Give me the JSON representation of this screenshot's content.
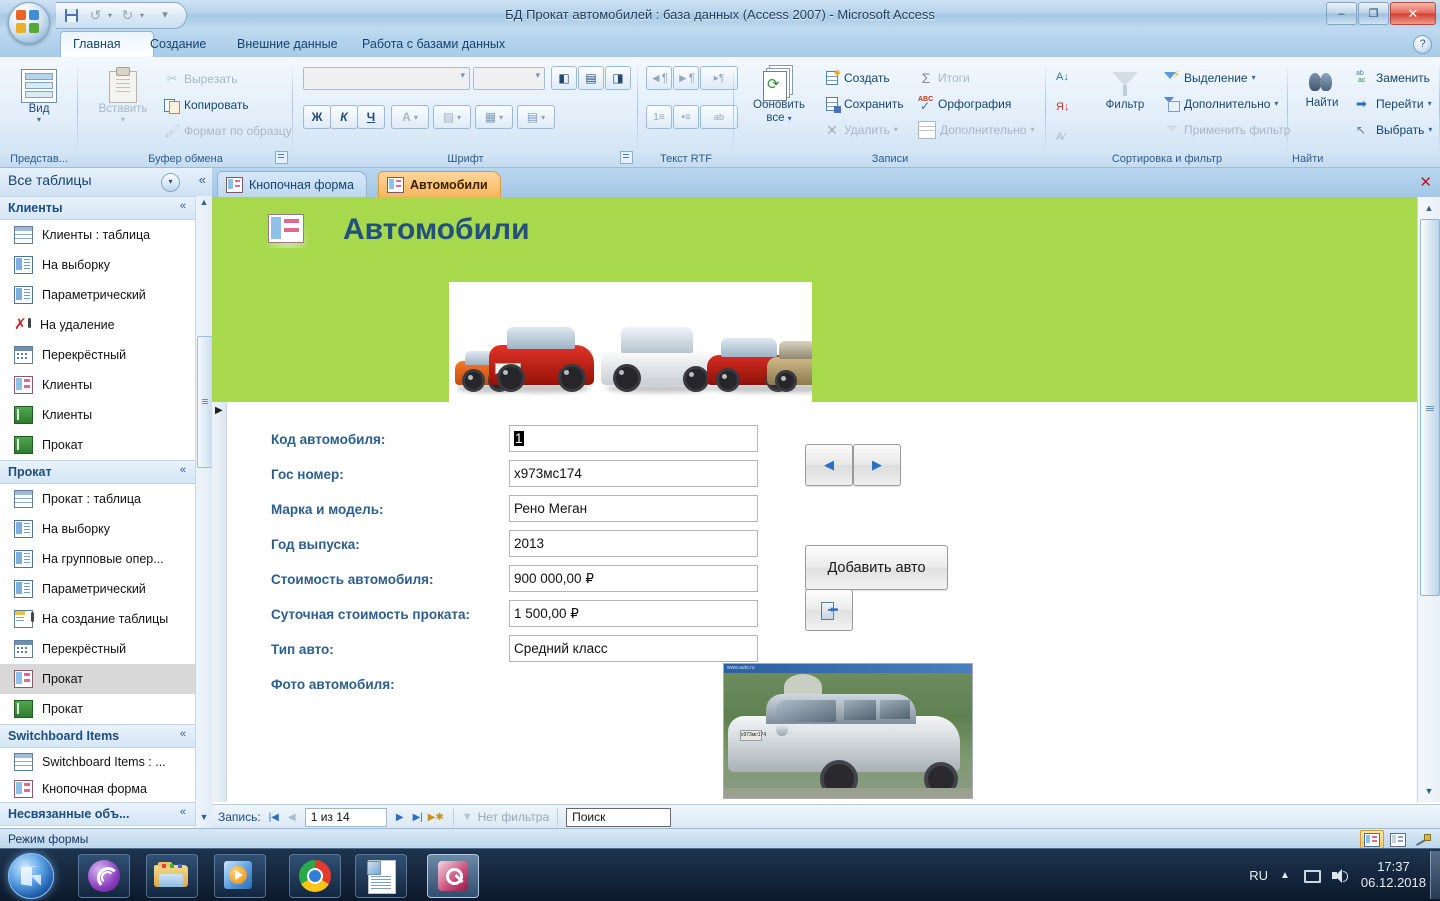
{
  "window": {
    "title": "БД Прокат автомобилей : база данных (Access 2007) - Microsoft Access",
    "minimize": "–",
    "restore": "❐",
    "close": "✕",
    "help": "?"
  },
  "quick_access": {
    "save": "save-icon",
    "undo": "↺",
    "redo": "↻",
    "customize": "▾"
  },
  "ribbon": {
    "tabs": [
      {
        "label": "Главная",
        "active": true
      },
      {
        "label": "Создание",
        "active": false
      },
      {
        "label": "Внешние данные",
        "active": false
      },
      {
        "label": "Работа с базами данных",
        "active": false
      }
    ],
    "groups": [
      {
        "name": "Представ...",
        "big_button": {
          "label": "Вид",
          "caret": "▾"
        }
      },
      {
        "name": "Буфер обмена",
        "paste": "Вставить",
        "paste_caret": "▾",
        "items": [
          {
            "label": "Вырезать",
            "dim": true,
            "icon": "scissors-icon"
          },
          {
            "label": "Копировать",
            "dim": false,
            "icon": "copy-icon"
          },
          {
            "label": "Формат по образцу",
            "dim": true,
            "icon": "format-painter-icon"
          }
        ]
      },
      {
        "name": "Шрифт",
        "bold": "Ж",
        "italic": "К",
        "underline": "Ч",
        "font_color": "A",
        "fill_color": "▨",
        "gridlines": "▦",
        "alt_fill": "▤",
        "align_left": "◧",
        "align_center": "▤",
        "align_right": "◨"
      },
      {
        "name": "Текст RTF",
        "indent_dec": "◄¶",
        "indent_inc": "►¶",
        "direction": "▸¶",
        "num_list": "1≡",
        "bul_list": "•≡",
        "highlight": "ab"
      },
      {
        "name": "Записи",
        "refresh": {
          "label_line1": "Обновить",
          "label_line2": "все",
          "caret": "▾"
        },
        "items": [
          {
            "label": "Создать",
            "dim": false
          },
          {
            "label": "Итоги",
            "dim": true
          },
          {
            "label": "Сохранить",
            "dim": false
          },
          {
            "label": "Орфография",
            "dim": false
          },
          {
            "label": "Удалить",
            "dim": true,
            "caret": "▾"
          },
          {
            "label": "Дополнительно",
            "dim": true,
            "caret": "▾"
          }
        ]
      },
      {
        "name": "Сортировка и фильтр",
        "sort_az": "А↓",
        "sort_za": "Я↓",
        "clear_sort": "A⁄",
        "filter": "Фильтр",
        "items": [
          {
            "label": "Выделение",
            "dim": false,
            "caret": "▾"
          },
          {
            "label": "Дополнительно",
            "dim": false,
            "caret": "▾"
          },
          {
            "label": "Применить фильтр",
            "dim": true
          }
        ]
      },
      {
        "name": "Найти",
        "find": "Найти",
        "items": [
          {
            "label": "Заменить",
            "dim": false
          },
          {
            "label": "Перейти",
            "dim": false,
            "caret": "▾"
          },
          {
            "label": "Выбрать",
            "dim": false,
            "caret": "▾"
          }
        ]
      }
    ]
  },
  "nav_pane": {
    "header": "Все таблицы",
    "dropdown": "▾",
    "collapse": "«",
    "scroll_up": "▲",
    "scroll_down": "▼",
    "groups": [
      {
        "title": "Клиенты",
        "chevron": "«",
        "items": [
          {
            "label": "Клиенты : таблица",
            "icon": "table-icon",
            "selected": false
          },
          {
            "label": "На выборку",
            "icon": "query-icon",
            "selected": false
          },
          {
            "label": "Параметрический",
            "icon": "query-icon",
            "selected": false
          },
          {
            "label": "На удаление",
            "icon": "delete-query-icon",
            "selected": false
          },
          {
            "label": "Перекрёстный",
            "icon": "crosstab-query-icon",
            "selected": false
          },
          {
            "label": "Клиенты",
            "icon": "form-icon",
            "selected": false
          },
          {
            "label": "Клиенты",
            "icon": "report-icon",
            "selected": false
          },
          {
            "label": "Прокат",
            "icon": "report-icon",
            "selected": false
          }
        ]
      },
      {
        "title": "Прокат",
        "chevron": "«",
        "items": [
          {
            "label": "Прокат : таблица",
            "icon": "table-icon",
            "selected": false
          },
          {
            "label": "На выборку",
            "icon": "query-icon",
            "selected": false
          },
          {
            "label": "На групповые опер...",
            "icon": "query-icon",
            "selected": false
          },
          {
            "label": "Параметрический",
            "icon": "query-icon",
            "selected": false
          },
          {
            "label": "На создание таблицы",
            "icon": "maketable-query-icon",
            "selected": false
          },
          {
            "label": "Перекрёстный",
            "icon": "crosstab-query-icon",
            "selected": false
          },
          {
            "label": "Прокат",
            "icon": "form-icon",
            "selected": true
          },
          {
            "label": "Прокат",
            "icon": "report-icon",
            "selected": false
          }
        ]
      },
      {
        "title": "Switchboard Items",
        "chevron": "«",
        "items": [
          {
            "label": "Switchboard Items : ...",
            "icon": "table-icon",
            "selected": false
          },
          {
            "label": "Кнопочная форма",
            "icon": "form-icon",
            "selected": false
          }
        ]
      },
      {
        "title": "Несвязанные объ...",
        "chevron": "«",
        "items": []
      }
    ]
  },
  "doc_tabs": [
    {
      "label": "Кнопочная форма",
      "active": false
    },
    {
      "label": "Автомобили",
      "active": true
    }
  ],
  "doc_close": "✕",
  "form": {
    "title": "Автомобили",
    "header_color": "#a8d84b",
    "title_color": "#23517d",
    "record_selector": "▶",
    "fields": [
      {
        "label": "Код автомобиля:",
        "value": "1",
        "selected": true
      },
      {
        "label": "Гос номер:",
        "value": "х973мс174",
        "selected": false
      },
      {
        "label": "Марка и модель:",
        "value": "Рено Меган",
        "selected": false
      },
      {
        "label": "Год выпуска:",
        "value": "2013",
        "selected": false
      },
      {
        "label": "Стоимость автомобиля:",
        "value": "900 000,00 ₽",
        "selected": false
      },
      {
        "label": "Суточная стоимость проката:",
        "value": "1 500,00 ₽",
        "selected": false
      },
      {
        "label": "Тип авто:",
        "value": "Средний класс",
        "selected": false
      },
      {
        "label": "Фото автомобиля:",
        "value": "",
        "selected": false
      }
    ],
    "photo_plate": "х973мс174",
    "buttons": {
      "prev": "◀",
      "next": "▶",
      "add": "Добавить авто",
      "exit": "exit-door-icon"
    }
  },
  "record_nav": {
    "label": "Запись:",
    "first": "|◀",
    "prev": "◀",
    "counter": "1 из 14",
    "next": "▶",
    "last": "▶|",
    "new": "▶✱",
    "filter_status": "Нет фильтра",
    "search_placeholder": "Поиск",
    "search_value": "Поиск"
  },
  "status_bar": {
    "text": "Режим формы",
    "views": [
      {
        "name": "form-view-icon",
        "active": true
      },
      {
        "name": "layout-view-icon",
        "active": false
      },
      {
        "name": "design-view-icon",
        "active": false
      }
    ]
  },
  "taskbar": {
    "start": "start-orb",
    "items": [
      {
        "name": "bittorrent-icon",
        "active": false
      },
      {
        "name": "explorer-icon",
        "active": false
      },
      {
        "name": "media-player-icon",
        "active": false
      },
      {
        "name": "chrome-icon",
        "active": false
      },
      {
        "name": "word-document-icon",
        "active": false
      },
      {
        "name": "access-icon",
        "active": true
      }
    ],
    "tray": {
      "language": "RU",
      "show_hidden": "▲",
      "network": "network-icon",
      "volume": "volume-icon",
      "time": "17:37",
      "date": "06.12.2018"
    }
  }
}
